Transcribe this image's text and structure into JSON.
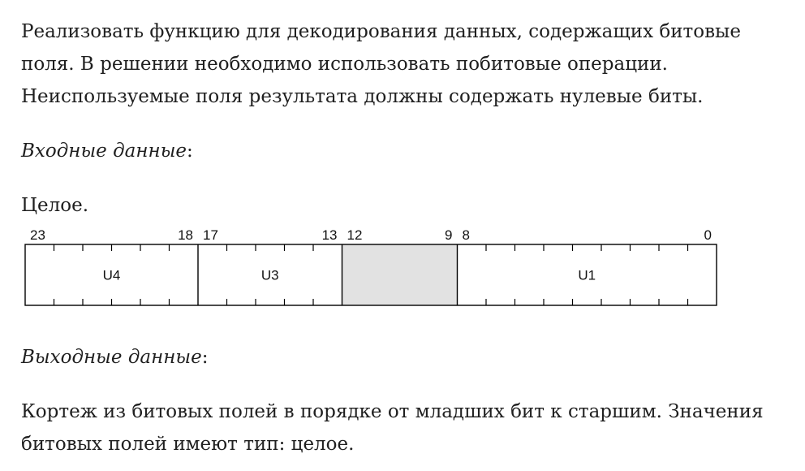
{
  "intro": {
    "line1": "Реализовать функцию для декодирования данных, содержащих битовые",
    "line2": "поля. В решении необходимо использовать побитовые операции.",
    "line3": "Неиспользуемые поля результата должны содержать нулевые биты."
  },
  "input": {
    "heading": "Входные данные",
    "colon": ":",
    "type": "Целое."
  },
  "diagram": {
    "bit_labels": [
      "23",
      "18",
      "17",
      "13",
      "12",
      "9",
      "8",
      "0"
    ],
    "fields": [
      {
        "name": "U4",
        "high_bit": 23,
        "low_bit": 18,
        "unused": false
      },
      {
        "name": "U3",
        "high_bit": 17,
        "low_bit": 13,
        "unused": false
      },
      {
        "name": "",
        "high_bit": 12,
        "low_bit": 9,
        "unused": true
      },
      {
        "name": "U1",
        "high_bit": 8,
        "low_bit": 0,
        "unused": false
      }
    ]
  },
  "output": {
    "heading": "Выходные данные",
    "colon": ":",
    "line1": "Кортеж из битовых полей в порядке от младших бит к старшим. Значения",
    "line2": "битовых полей имеют тип: целое."
  },
  "colors": {
    "text": "#1f1f1f",
    "unused_field_fill": "#e2e2e2",
    "border": "#000000"
  }
}
